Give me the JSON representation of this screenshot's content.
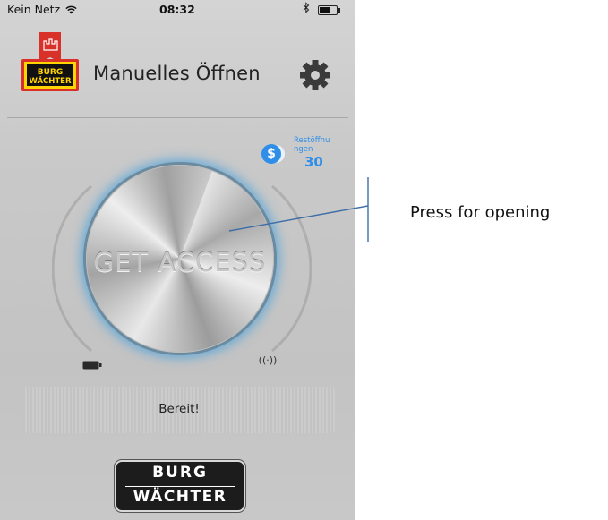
{
  "status_bar": {
    "carrier": "Kein Netz",
    "time": "08:32"
  },
  "header": {
    "logo_text_top": "BURG",
    "logo_text_bottom": "WÄCHTER",
    "title": "Manuelles Öffnen",
    "settings_icon": "gear-icon"
  },
  "credits": {
    "icon": "coin-icon",
    "label": "Restöffnu ngen",
    "count": "30",
    "color": "#2f8fe8"
  },
  "main": {
    "access_button_label": "GET ACCESS",
    "glow_color": "#46a0dc",
    "battery_icon": "battery-icon",
    "signal_icon": "signal-icon",
    "signal_glyph": "((·))"
  },
  "status_panel": {
    "text": "Bereit!"
  },
  "footer": {
    "brand_top": "BURG",
    "brand_bottom": "WÄCHTER"
  },
  "annotation": {
    "text": "Press for opening"
  }
}
